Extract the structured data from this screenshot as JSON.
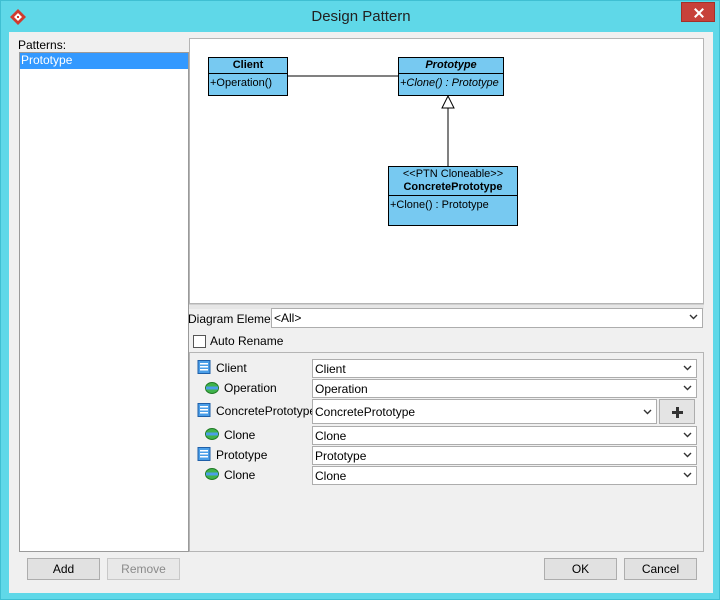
{
  "window": {
    "title": "Design Pattern"
  },
  "patterns": {
    "label": "Patterns:",
    "items": [
      "Prototype"
    ],
    "selected": "Prototype"
  },
  "diagram": {
    "client": {
      "name": "Client",
      "operation": "+Operation()"
    },
    "prototype": {
      "name": "Prototype",
      "operation": "+Clone() : Prototype"
    },
    "concrete": {
      "stereotype": "<<PTN Cloneable>>",
      "name": "ConcretePrototype",
      "operation": "+Clone() : Prototype"
    }
  },
  "filter": {
    "label": "Diagram Element",
    "value": "<All>"
  },
  "auto_rename": {
    "label": "Auto Rename",
    "checked": false
  },
  "bindings": [
    {
      "label": "Client",
      "value": "Client",
      "kind": "class"
    },
    {
      "label": "Operation",
      "value": "Operation",
      "kind": "operation"
    },
    {
      "label": "ConcretePrototype",
      "value": "ConcretePrototype",
      "kind": "class"
    },
    {
      "label": "Clone",
      "value": "Clone",
      "kind": "operation"
    },
    {
      "label": "Prototype",
      "value": "Prototype",
      "kind": "class"
    },
    {
      "label": "Clone",
      "value": "Clone",
      "kind": "operation"
    }
  ],
  "buttons": {
    "add": "Add",
    "remove": "Remove",
    "ok": "OK",
    "cancel": "Cancel"
  },
  "colors": {
    "titlebar": "#5fd8e8",
    "uml_fill": "#77c9f1",
    "selection": "#3399ff",
    "close": "#c7413a"
  },
  "icons": {
    "app": "design-pattern-app-icon",
    "class": "class-icon",
    "operation": "operation-icon",
    "add_binding": "plus-icon",
    "dropdown": "chevron-down-icon"
  }
}
